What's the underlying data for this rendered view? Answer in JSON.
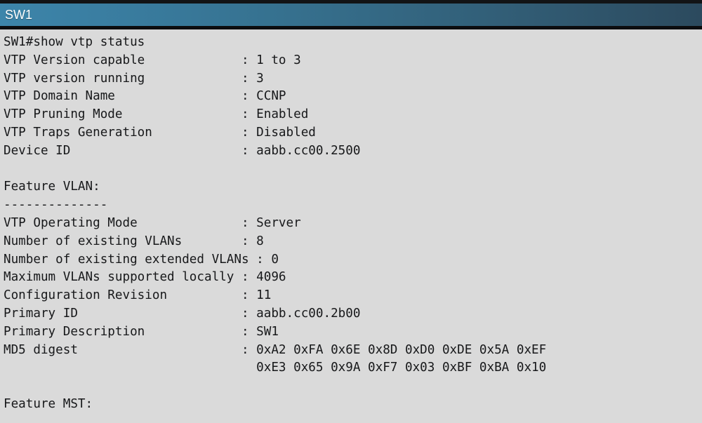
{
  "window": {
    "title": "SW1",
    "title_bar_gradient_start": "#3d85aa",
    "title_bar_gradient_end": "#2c4a5e",
    "title_text_color": "#ffffff",
    "terminal_background": "#dadada",
    "terminal_text_color": "#17181a"
  },
  "terminal": {
    "prompt_line": "SW1#show vtp status",
    "command": "show vtp status",
    "hostname": "SW1",
    "lines": [
      "SW1#show vtp status",
      "VTP Version capable             : 1 to 3",
      "VTP version running             : 3",
      "VTP Domain Name                 : CCNP",
      "VTP Pruning Mode                : Enabled",
      "VTP Traps Generation            : Disabled",
      "Device ID                       : aabb.cc00.2500",
      "",
      "Feature VLAN:",
      "--------------",
      "VTP Operating Mode              : Server",
      "Number of existing VLANs        : 8",
      "Number of existing extended VLANs : 0",
      "Maximum VLANs supported locally : 4096",
      "Configuration Revision          : 11",
      "Primary ID                      : aabb.cc00.2b00",
      "Primary Description             : SW1",
      "MD5 digest                      : 0xA2 0xFA 0x6E 0x8D 0xD0 0xDE 0x5A 0xEF",
      "                                  0xE3 0x65 0x9A 0xF7 0x03 0xBF 0xBA 0x10",
      "",
      "Feature MST:"
    ],
    "fields": {
      "vtp_version_capable": "1 to 3",
      "vtp_version_running": "3",
      "vtp_domain_name": "CCNP",
      "vtp_pruning_mode": "Enabled",
      "vtp_traps_generation": "Disabled",
      "device_id": "aabb.cc00.2500",
      "vtp_operating_mode": "Server",
      "number_of_existing_vlans": "8",
      "number_of_existing_extended_vlans": "0",
      "maximum_vlans_supported_locally": "4096",
      "configuration_revision": "11",
      "primary_id": "aabb.cc00.2b00",
      "primary_description": "SW1",
      "md5_digest_line_1": "0xA2 0xFA 0x6E 0x8D 0xD0 0xDE 0x5A 0xEF",
      "md5_digest_line_2": "0xE3 0x65 0x9A 0xF7 0x03 0xBF 0xBA 0x10"
    },
    "sections": {
      "feature_vlan_header": "Feature VLAN:",
      "feature_vlan_rule": "--------------",
      "feature_mst_header": "Feature MST:"
    }
  }
}
